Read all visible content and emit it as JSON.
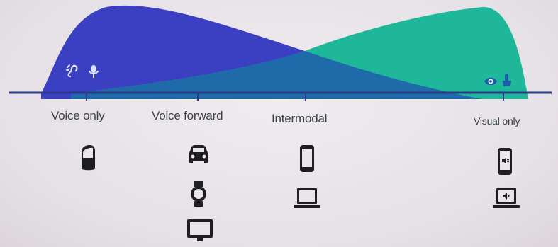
{
  "colors": {
    "background": "#e9e5e9",
    "voice_curve": "#3b3fc2",
    "visual_curve": "#1fb79a",
    "overlap": "#1f6aa8",
    "axis": "#2b3a86",
    "text": "#3a3f47",
    "device": "#1e1e22"
  },
  "spectrum": {
    "stops": [
      {
        "label": "Voice only"
      },
      {
        "label": "Voice forward"
      },
      {
        "label": "Intermodal"
      },
      {
        "label": "Visual only"
      }
    ]
  },
  "mode_icons": {
    "voice_side": [
      "hearing-icon",
      "microphone-icon"
    ],
    "visual_side": [
      "eye-icon",
      "touch-icon"
    ]
  },
  "devices": {
    "voice_only": [
      "smart-speaker-icon"
    ],
    "voice_forward": [
      "car-icon",
      "smartwatch-icon",
      "tv-icon"
    ],
    "intermodal": [
      "phone-icon",
      "laptop-icon"
    ],
    "visual_only": [
      "phone-muted-icon",
      "laptop-muted-icon"
    ]
  }
}
